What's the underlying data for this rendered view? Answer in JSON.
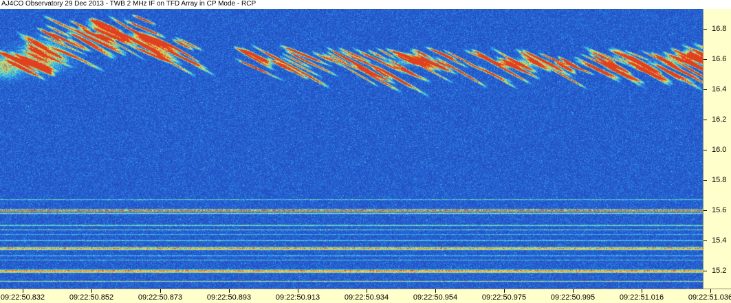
{
  "window": {
    "title": "AJ4CO Observatory 29 Dec 2013 - TWB 2 MHz IF on TFD Array in CP Mode - RCP"
  },
  "chart_data": {
    "type": "heatmap",
    "title": "AJ4CO Observatory 29 Dec 2013 - TWB 2 MHz IF on TFD Array in CP Mode - RCP",
    "xlabel": "",
    "ylabel": "",
    "x_axis_position": "bottom",
    "y_axis_position": "right",
    "ylim": [
      15.08,
      16.93
    ],
    "xlim": [
      "09:22:50.832",
      "09:22:51.036"
    ],
    "y_ticks": [
      "15.2",
      "15.4",
      "15.6",
      "15.8",
      "16.0",
      "16.2",
      "16.4",
      "16.6",
      "16.8"
    ],
    "x_ticks": [
      "09:22:50.832",
      "09:22:50.852",
      "09:22:50.873",
      "09:22:50.893",
      "09:22:50.913",
      "09:22:50.934",
      "09:22:50.954",
      "09:22:50.975",
      "09:22:50.995",
      "09:22:51.016",
      "09:22:51.036"
    ],
    "colormap": [
      "#1b35a0",
      "#2450c8",
      "#2a7fe0",
      "#3fc0e8",
      "#7fe0a0",
      "#e8e060",
      "#f0a040",
      "#e04020"
    ],
    "background_color": "#1a3aa6",
    "features": {
      "interference_lines_mhz": [
        15.67,
        15.6,
        15.58,
        15.5,
        15.47,
        15.44,
        15.4,
        15.35,
        15.34,
        15.3,
        15.27,
        15.2,
        15.19,
        15.13
      ],
      "burst_band_mhz": [
        16.35,
        16.85
      ],
      "description_type": "drifting S-burst emission"
    }
  }
}
